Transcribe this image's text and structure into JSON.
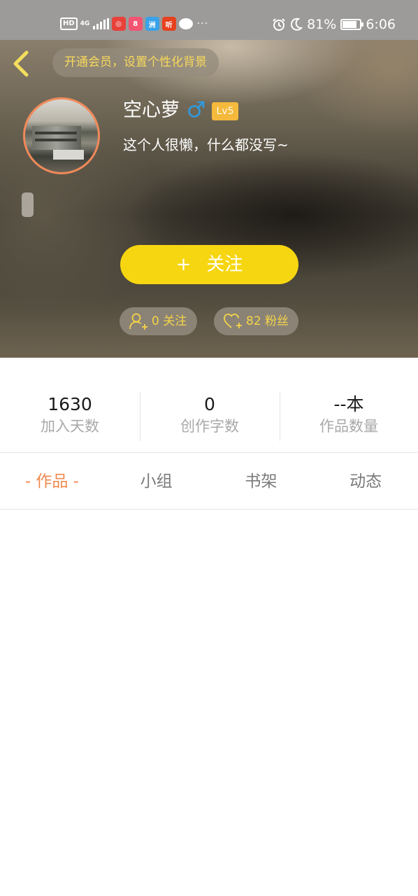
{
  "status_bar": {
    "left_badges": [
      "HD",
      "4G"
    ],
    "app_icons": [
      {
        "name": "app-icon-1",
        "color": "#e8413a",
        "glyph": "◎"
      },
      {
        "name": "app-icon-2",
        "color": "#f25472",
        "glyph": "8"
      },
      {
        "name": "app-icon-3",
        "color": "#3aa2e8",
        "glyph": "洲"
      },
      {
        "name": "app-icon-4",
        "color": "#e8411f",
        "glyph": "听"
      }
    ],
    "more": "···",
    "battery": "81%",
    "battery_level": 0.81,
    "time": "6:06"
  },
  "header": {
    "vip_banner": "开通会员，设置个性化背景",
    "username": "空心萝",
    "gender_symbol": "♂",
    "level": "Lv5",
    "signature": "这个人很懒，什么都没写~",
    "follow_plus": "+",
    "follow_label": "关注",
    "following_label": "0 关注",
    "fans_label": "82 粉丝"
  },
  "stats": [
    {
      "value": "1630",
      "label": "加入天数"
    },
    {
      "value": "0",
      "label": "创作字数"
    },
    {
      "value": "--本",
      "label": "作品数量"
    }
  ],
  "tabs": [
    {
      "label": "- 作品 -",
      "active": true
    },
    {
      "label": "小组",
      "active": false
    },
    {
      "label": "书架",
      "active": false
    },
    {
      "label": "动态",
      "active": false
    }
  ],
  "colors": {
    "accent_yellow": "#f6d611",
    "active_tab": "#ef8a4f",
    "level_badge": "#f5b93c",
    "gender_blue": "#2f9be0"
  }
}
